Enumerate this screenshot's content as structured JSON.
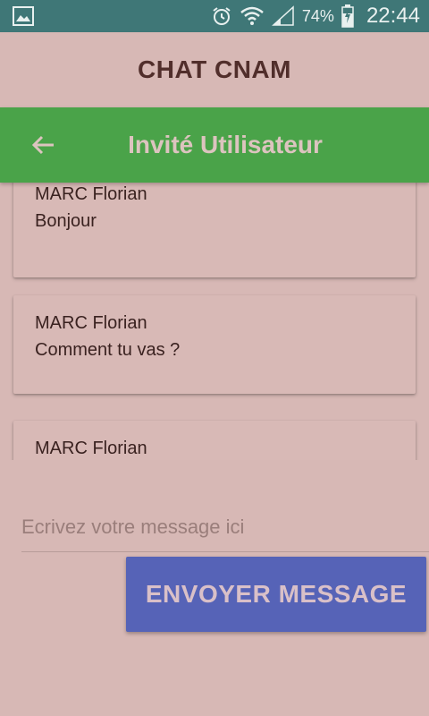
{
  "status_bar": {
    "battery_percent": "74%",
    "time": "22:44",
    "icons": [
      "gallery-icon",
      "alarm-icon",
      "wifi-icon",
      "signal-icon",
      "battery-charging-icon"
    ]
  },
  "app": {
    "title": "CHAT CNAM"
  },
  "toolbar": {
    "title": "Invité Utilisateur",
    "back_icon": "arrow-back-icon"
  },
  "messages": [
    {
      "author": "MARC Florian",
      "text": "Bonjour"
    },
    {
      "author": "MARC Florian",
      "text": "Comment tu vas ?"
    },
    {
      "author": "MARC Florian",
      "text": ""
    }
  ],
  "composer": {
    "placeholder": "Ecrivez votre message ici",
    "value": "",
    "send_label": "ENVOYER MESSAGE"
  },
  "colors": {
    "status_bar": "#3f7777",
    "background": "#d7b8b5",
    "toolbar": "#4aa349",
    "send_button": "#5663b7"
  }
}
